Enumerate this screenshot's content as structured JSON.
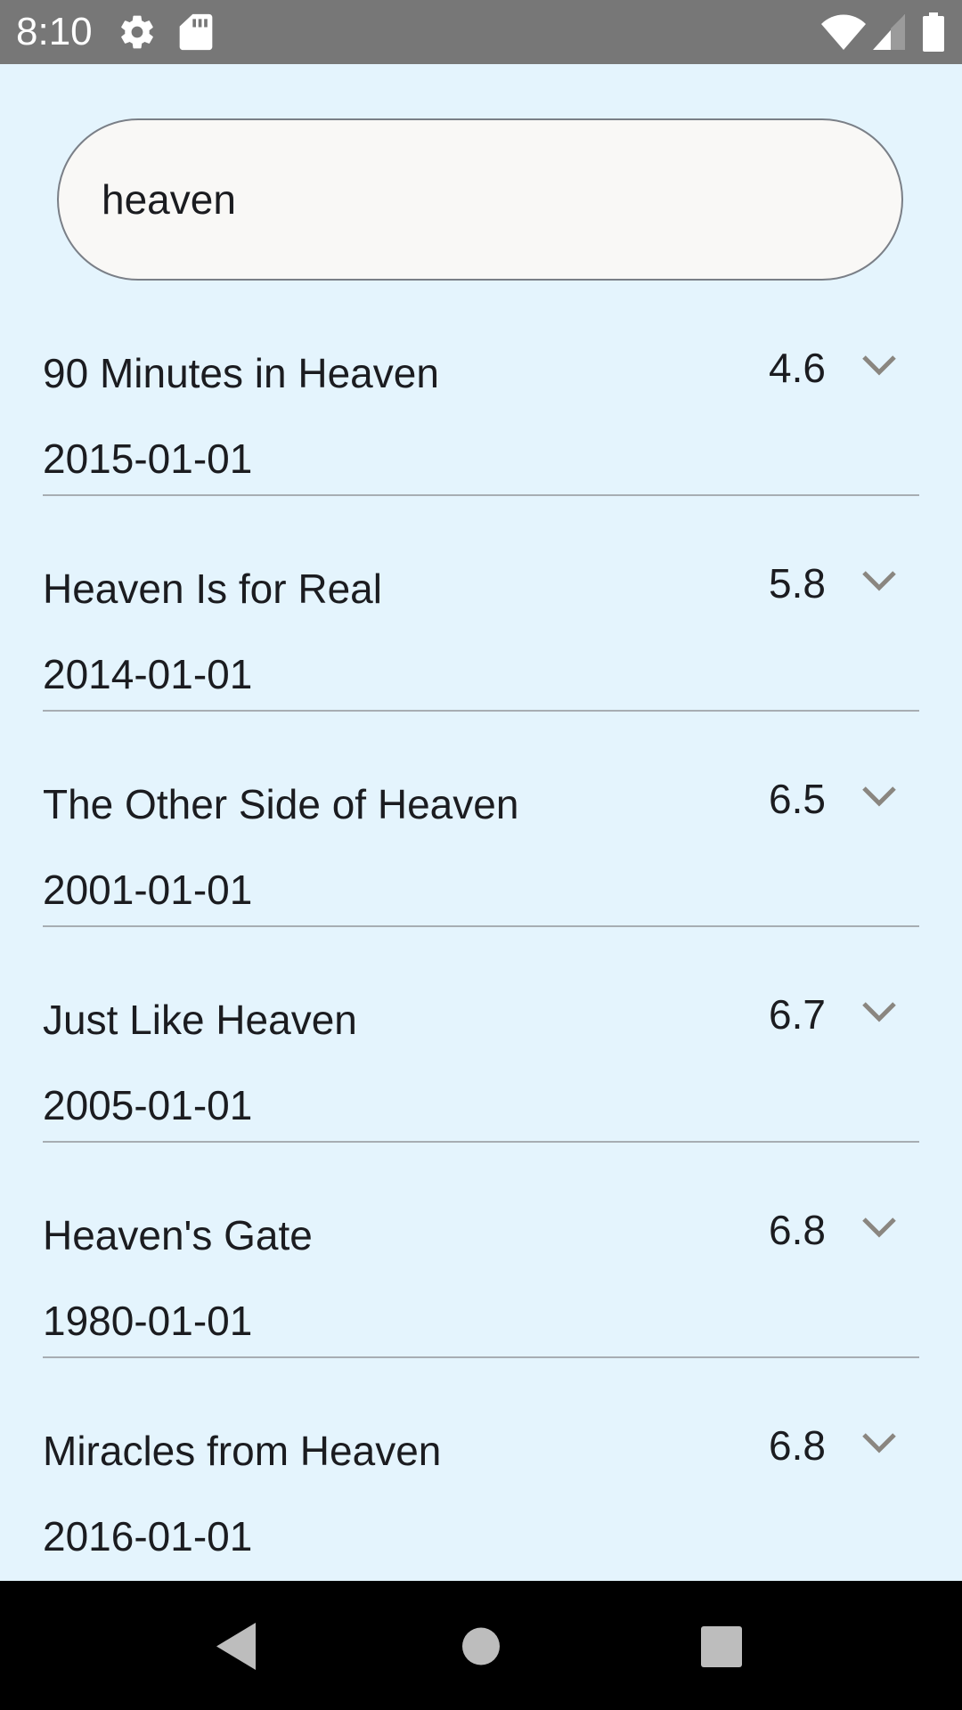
{
  "status_bar": {
    "time": "8:10",
    "icons": [
      "settings-icon",
      "sd-card-icon",
      "wifi-icon",
      "signal-icon",
      "battery-icon"
    ]
  },
  "search": {
    "value": "heaven",
    "placeholder": ""
  },
  "results": [
    {
      "title": "90 Minutes in Heaven",
      "date": "2015-01-01",
      "rating": "4.6"
    },
    {
      "title": "Heaven Is for Real",
      "date": "2014-01-01",
      "rating": "5.8"
    },
    {
      "title": "The Other Side of Heaven",
      "date": "2001-01-01",
      "rating": "6.5"
    },
    {
      "title": "Just Like Heaven",
      "date": "2005-01-01",
      "rating": "6.7"
    },
    {
      "title": "Heaven's Gate",
      "date": "1980-01-01",
      "rating": "6.8"
    },
    {
      "title": "Miracles from Heaven",
      "date": "2016-01-01",
      "rating": "6.8"
    }
  ],
  "nav_bar": {
    "icons": [
      "back-icon",
      "home-icon",
      "recents-icon"
    ]
  },
  "colors": {
    "background": "#e4f4fd",
    "status_bar": "#777777",
    "caret": "#00897b",
    "chevron": "#8a8680",
    "divider": "#a7adb3"
  }
}
